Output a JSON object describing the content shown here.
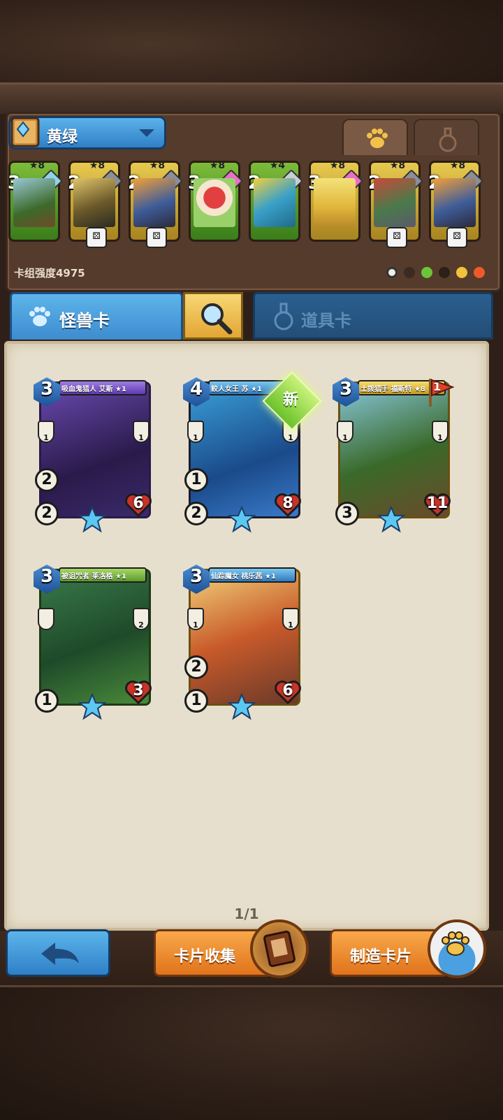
{
  "deck": {
    "name": "黄绿",
    "power_label": "卡组强度4975",
    "cards": [
      {
        "stars": "★8",
        "cost": "3",
        "gem_color": "#8fd3e8",
        "badge": "weapon"
      },
      {
        "stars": "★8",
        "cost": "2",
        "gem_color": "#9aa0a8",
        "badge": "dice"
      },
      {
        "stars": "★8",
        "cost": "2",
        "gem_color": "#9aa0a8",
        "badge": "dice"
      },
      {
        "stars": "★8",
        "cost": "3",
        "gem_color": "#e96fc7",
        "badge": ""
      },
      {
        "stars": "★4",
        "cost": "2",
        "gem_color": "#c7ced6",
        "badge": "sword"
      },
      {
        "stars": "★8",
        "cost": "3",
        "gem_color": "#e96fc7",
        "badge": ""
      },
      {
        "stars": "★8",
        "cost": "2",
        "gem_color": "#9aa0a8",
        "badge": "dice"
      },
      {
        "stars": "★8",
        "cost": "2",
        "gem_color": "#9aa0a8",
        "badge": "dice"
      }
    ]
  },
  "tabs": {
    "monster_label": "怪兽卡",
    "item_label": "道具卡"
  },
  "collection": {
    "page": "1/1",
    "cards": [
      {
        "title": "吸血鬼猎人 艾斯 ★1",
        "cost": "3",
        "left_top": "1",
        "right_top": "1",
        "atk_a": "2",
        "atk_b": "2",
        "hp": "6",
        "ribbon": "purple"
      },
      {
        "title": "鲛人女王 苏 ★1",
        "cost": "4",
        "left_top": "1",
        "right_top": "1",
        "atk_a": "1",
        "atk_b": "2",
        "hp": "8",
        "ribbon": "blue"
      },
      {
        "title": "土拨猎手 福斯特 ★8",
        "cost": "3",
        "left_top": "1",
        "right_top": "1",
        "atk_a": "3",
        "atk_b": "",
        "hp": "11",
        "ribbon": "gold"
      },
      {
        "title": "被诅咒者 莱洛格 ★1",
        "cost": "3",
        "left_top": "",
        "right_top": "2",
        "atk_a": "1",
        "atk_b": "",
        "hp": "3",
        "ribbon": "green"
      },
      {
        "title": "仙踪魔女 桃乐茜 ★1",
        "cost": "3",
        "left_top": "1",
        "right_top": "1",
        "atk_a": "2",
        "atk_b": "1",
        "hp": "6",
        "ribbon": "gold"
      }
    ],
    "new_badge": "新",
    "flag_count": "1"
  },
  "buttons": {
    "collect_label": "卡片收集",
    "craft_label": "制造卡片"
  }
}
